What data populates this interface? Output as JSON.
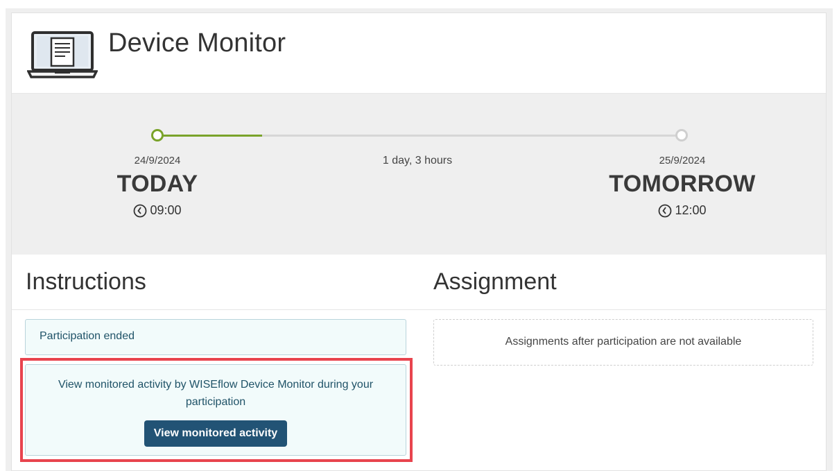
{
  "header": {
    "title": "Device Monitor",
    "icon": "laptop-document-icon"
  },
  "timeline": {
    "start_date": "24/9/2024",
    "start_label": "TODAY",
    "start_time": "09:00",
    "duration": "1 day, 3 hours",
    "end_date": "25/9/2024",
    "end_label": "TOMORROW",
    "end_time": "12:00",
    "progress_fraction": 0.2,
    "progress_color": "#7aa32a",
    "track_color": "#d6d6d6",
    "time_icon": "clock-icon"
  },
  "instructions": {
    "title": "Instructions",
    "status_message": "Participation ended",
    "monitor_message": "View monitored activity by WISEflow Device Monitor during your participation",
    "monitor_button": "View monitored activity",
    "highlight_color": "#e8444e",
    "button_color": "#225375"
  },
  "assignment": {
    "title": "Assignment",
    "empty_message": "Assignments after participation are not available"
  }
}
